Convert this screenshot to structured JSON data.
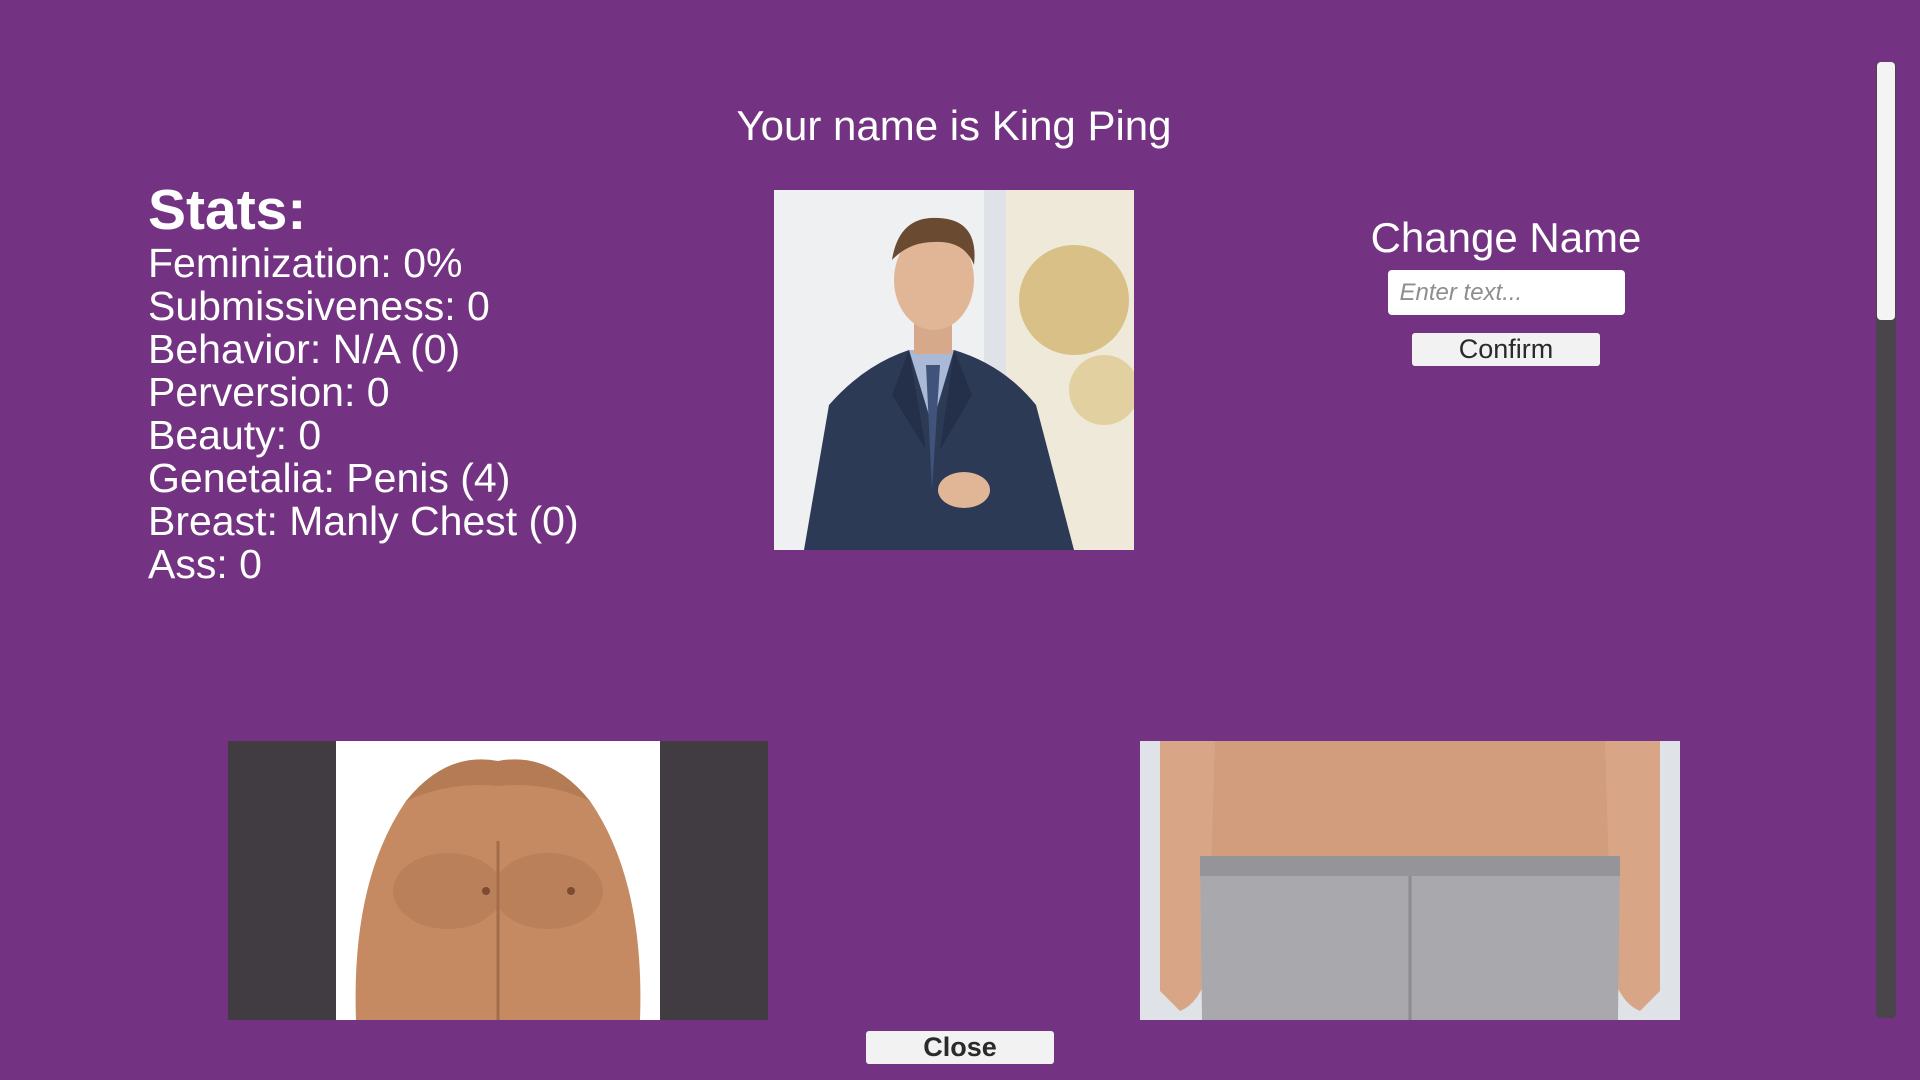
{
  "header": {
    "title": "Your name is King Ping"
  },
  "stats": {
    "heading": "Stats:",
    "lines": [
      "Feminization: 0%",
      "Submissiveness: 0",
      "Behavior: N/A (0)",
      "Perversion: 0",
      "Beauty: 0",
      "Genetalia: Penis (4)",
      "Breast: Manly Chest (0)",
      "Ass: 0"
    ]
  },
  "change_name": {
    "title": "Change Name",
    "input_value": "",
    "input_placeholder": "Enter text...",
    "confirm_label": "Confirm"
  },
  "images": {
    "portrait": "man-in-suit-portrait",
    "chest": "bare-male-chest",
    "ass": "male-back-in-grey-underwear"
  },
  "footer": {
    "close_label": "Close"
  },
  "colors": {
    "background": "#733382",
    "text": "#ffffff",
    "button_bg": "#f2f2f2",
    "scroll_track": "#49454a",
    "image_panel_dark": "#403c41"
  },
  "scroll": {
    "position_fraction": 0.0
  }
}
